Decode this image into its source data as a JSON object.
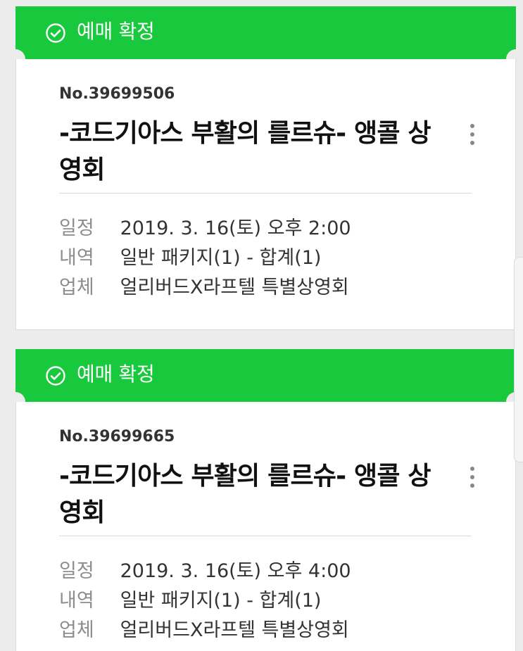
{
  "colors": {
    "accent": "#19c93d",
    "background": "#ececec",
    "card": "#ffffff"
  },
  "icons": {
    "status": "check-circle-icon",
    "more": "more-vertical-icon"
  },
  "reservations": [
    {
      "status": "예매 확정",
      "number": "No.39699506",
      "title": "-코드기아스 부활의 를르슈- 앵콜 상영회",
      "labels": {
        "schedule": "일정",
        "details": "내역",
        "vendor": "업체"
      },
      "values": {
        "schedule": "2019. 3. 16(토) 오후 2:00",
        "details": "일반 패키지(1) - 합계(1)",
        "vendor": "얼리버드X라프텔 특별상영회"
      }
    },
    {
      "status": "예매 확정",
      "number": "No.39699665",
      "title": "-코드기아스 부활의 를르슈- 앵콜 상영회",
      "labels": {
        "schedule": "일정",
        "details": "내역",
        "vendor": "업체"
      },
      "values": {
        "schedule": "2019. 3. 16(토) 오후 4:00",
        "details": "일반 패키지(1) - 합계(1)",
        "vendor": "얼리버드X라프텔 특별상영회"
      }
    }
  ]
}
